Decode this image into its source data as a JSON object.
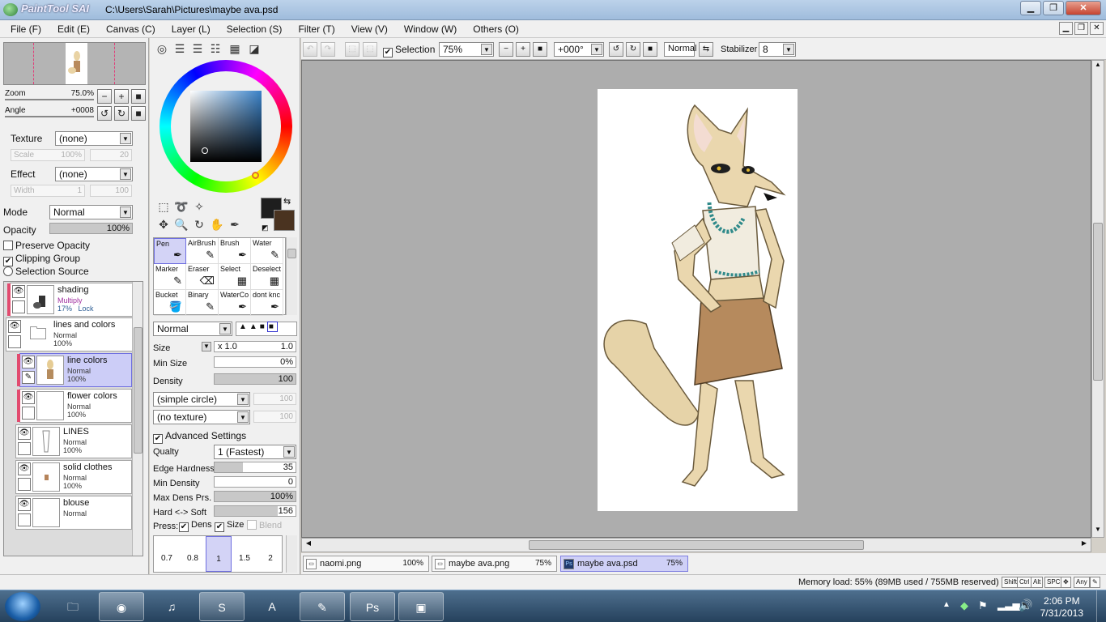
{
  "window": {
    "app_name": "PaintTool SAI",
    "title": "C:\\Users\\Sarah\\Pictures\\maybe ava.psd",
    "buttons": {
      "minimize": "▁",
      "maximize": "❐",
      "close": "✕"
    }
  },
  "menu": [
    "File (F)",
    "Edit (E)",
    "Canvas (C)",
    "Layer (L)",
    "Selection (S)",
    "Filter (T)",
    "View (V)",
    "Window (W)",
    "Others (O)"
  ],
  "navigator": {
    "zoom_label": "Zoom",
    "zoom_value": "75.0%",
    "angle_label": "Angle",
    "angle_value": "+0008"
  },
  "texture": {
    "label": "Texture",
    "value": "(none)",
    "scale_label": "Scale",
    "scale_value": "100%",
    "scale_num": "20"
  },
  "effect": {
    "label": "Effect",
    "value": "(none)",
    "width_label": "Width",
    "width_value": "1",
    "width_num": "100"
  },
  "layer_props": {
    "mode_label": "Mode",
    "mode_value": "Normal",
    "opacity_label": "Opacity",
    "opacity_value": "100%",
    "preserve_opacity": "Preserve Opacity",
    "clipping_group": "Clipping Group",
    "selection_source": "Selection Source"
  },
  "layers": [
    {
      "name": "shading",
      "blend": "Multiply",
      "opacity": "17%",
      "extra": "Lock"
    },
    {
      "name": "lines and colors",
      "blend": "Normal",
      "opacity": "100%"
    },
    {
      "name": "line colors",
      "blend": "Normal",
      "opacity": "100%"
    },
    {
      "name": "flower colors",
      "blend": "Normal",
      "opacity": "100%"
    },
    {
      "name": "LINES",
      "blend": "Normal",
      "opacity": "100%"
    },
    {
      "name": "solid clothes",
      "blend": "Normal",
      "opacity": "100%"
    },
    {
      "name": "blouse",
      "blend": "Normal",
      "opacity": ""
    }
  ],
  "brushes": [
    "Pen",
    "AirBrush",
    "Brush",
    "Water",
    "Marker",
    "Eraser",
    "Select",
    "Deselect",
    "Bucket",
    "Binary",
    "WaterCo",
    "dont knc"
  ],
  "brush_settings": {
    "blend": "Normal",
    "size_label": "Size",
    "size_mult": "x 1.0",
    "size_value": "1.0",
    "min_size_label": "Min Size",
    "min_size_value": "0%",
    "density_label": "Density",
    "density_value": "100",
    "shape": "(simple circle)",
    "shape_num": "100",
    "texture": "(no texture)",
    "texture_num": "100",
    "advanced": "Advanced Settings",
    "quality_label": "Qualty",
    "quality_value": "1 (Fastest)",
    "edge_label": "Edge Hardness",
    "edge_value": "35",
    "min_density_label": "Min Density",
    "min_density_value": "0",
    "max_dens_label": "Max Dens Prs.",
    "max_dens_value": "100%",
    "hard_soft_label": "Hard <-> Soft",
    "hard_soft_value": "156",
    "press_label": "Press:",
    "press_dens": "Dens",
    "press_size": "Size",
    "press_blend": "Blend",
    "sizes": [
      "0.7",
      "0.8",
      "1",
      "1.5",
      "2"
    ]
  },
  "canvas_toolbar": {
    "selection_label": "Selection",
    "zoom": "75%",
    "angle": "+000°",
    "blend": "Normal",
    "stabilizer_label": "Stabilizer",
    "stabilizer_value": "8"
  },
  "tabs": [
    {
      "name": "naomi.png",
      "zoom": "100%"
    },
    {
      "name": "maybe ava.png",
      "zoom": "75%"
    },
    {
      "name": "maybe ava.psd",
      "zoom": "75%"
    }
  ],
  "status": {
    "memory": "Memory load: 55% (89MB used / 755MB reserved)",
    "keys": [
      "Shift",
      "Ctrl",
      "Alt",
      "SPC",
      "Any"
    ]
  },
  "taskbar": {
    "time": "2:06 PM",
    "date": "7/31/2013"
  },
  "colors": {
    "primary": "#1e1e1e",
    "secondary": "#4a3320",
    "accent_selection": "#cccdf7",
    "layer_marker": "#e24b6f"
  }
}
